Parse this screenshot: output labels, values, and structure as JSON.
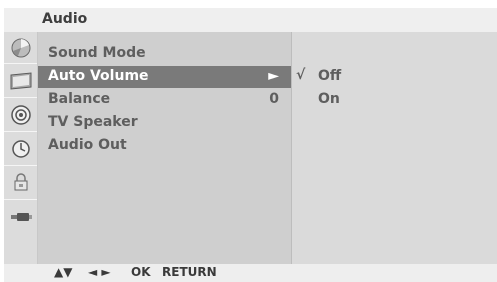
{
  "header": {
    "title": "Audio"
  },
  "rail_icons": [
    "picture-disc-icon",
    "screen-icon",
    "audio-speaker-icon",
    "clock-icon",
    "lock-icon",
    "input-plug-icon"
  ],
  "menu": {
    "items": [
      {
        "label": "Sound Mode",
        "value": ""
      },
      {
        "label": "Auto Volume",
        "value": "►"
      },
      {
        "label": "Balance",
        "value": "0"
      },
      {
        "label": "TV Speaker",
        "value": ""
      },
      {
        "label": "Audio Out",
        "value": ""
      }
    ],
    "selected_index": 1
  },
  "submenu": {
    "check_mark": "√",
    "options": [
      {
        "label": "Off",
        "checked": true
      },
      {
        "label": "On",
        "checked": false
      }
    ]
  },
  "footer": {
    "updown": "▲▼",
    "leftright": "◄ ►",
    "ok": "OK",
    "return": "RETURN"
  },
  "colors": {
    "selected_bg": "#7a7a7a",
    "panel_bg": "#cfcfcf"
  }
}
